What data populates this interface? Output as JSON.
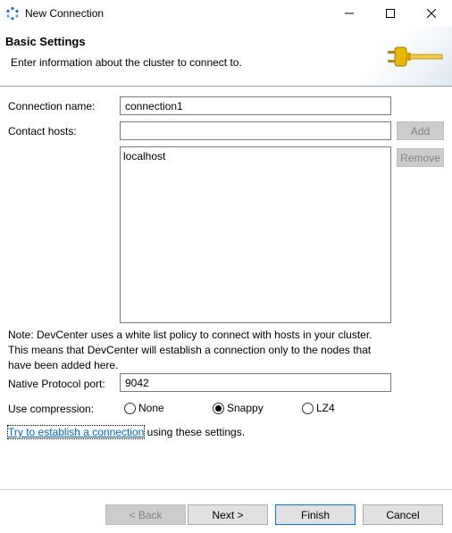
{
  "window": {
    "title": "New Connection",
    "minimize_icon": "minimize-icon",
    "maximize_icon": "maximize-icon",
    "close_icon": "close-icon"
  },
  "header": {
    "title": "Basic Settings",
    "description": "Enter information about the cluster to connect to.",
    "icon": "plug-icon"
  },
  "form": {
    "connection_name": {
      "label": "Connection name:",
      "value": "connection1"
    },
    "contact_hosts": {
      "label": "Contact hosts:",
      "value": "",
      "add_label": "Add",
      "remove_label": "Remove",
      "hosts": [
        "localhost"
      ]
    },
    "note": "Note: DevCenter uses a white list policy to connect with hosts in your cluster. This means that DevCenter will establish a connection only to the nodes that have been added here.",
    "native_port": {
      "label": "Native Protocol port:",
      "value": "9042"
    },
    "compression": {
      "label": "Use compression:",
      "options": [
        "None",
        "Snappy",
        "LZ4"
      ],
      "selected": "Snappy"
    },
    "try_connection": {
      "link_text": "Try to establish a connection",
      "suffix": " using these settings."
    }
  },
  "footer": {
    "back_label": "< Back",
    "next_label": "Next >",
    "finish_label": "Finish",
    "cancel_label": "Cancel"
  },
  "colors": {
    "accent": "#0078d7",
    "link": "#0066cc",
    "disabled_text": "#838383"
  }
}
